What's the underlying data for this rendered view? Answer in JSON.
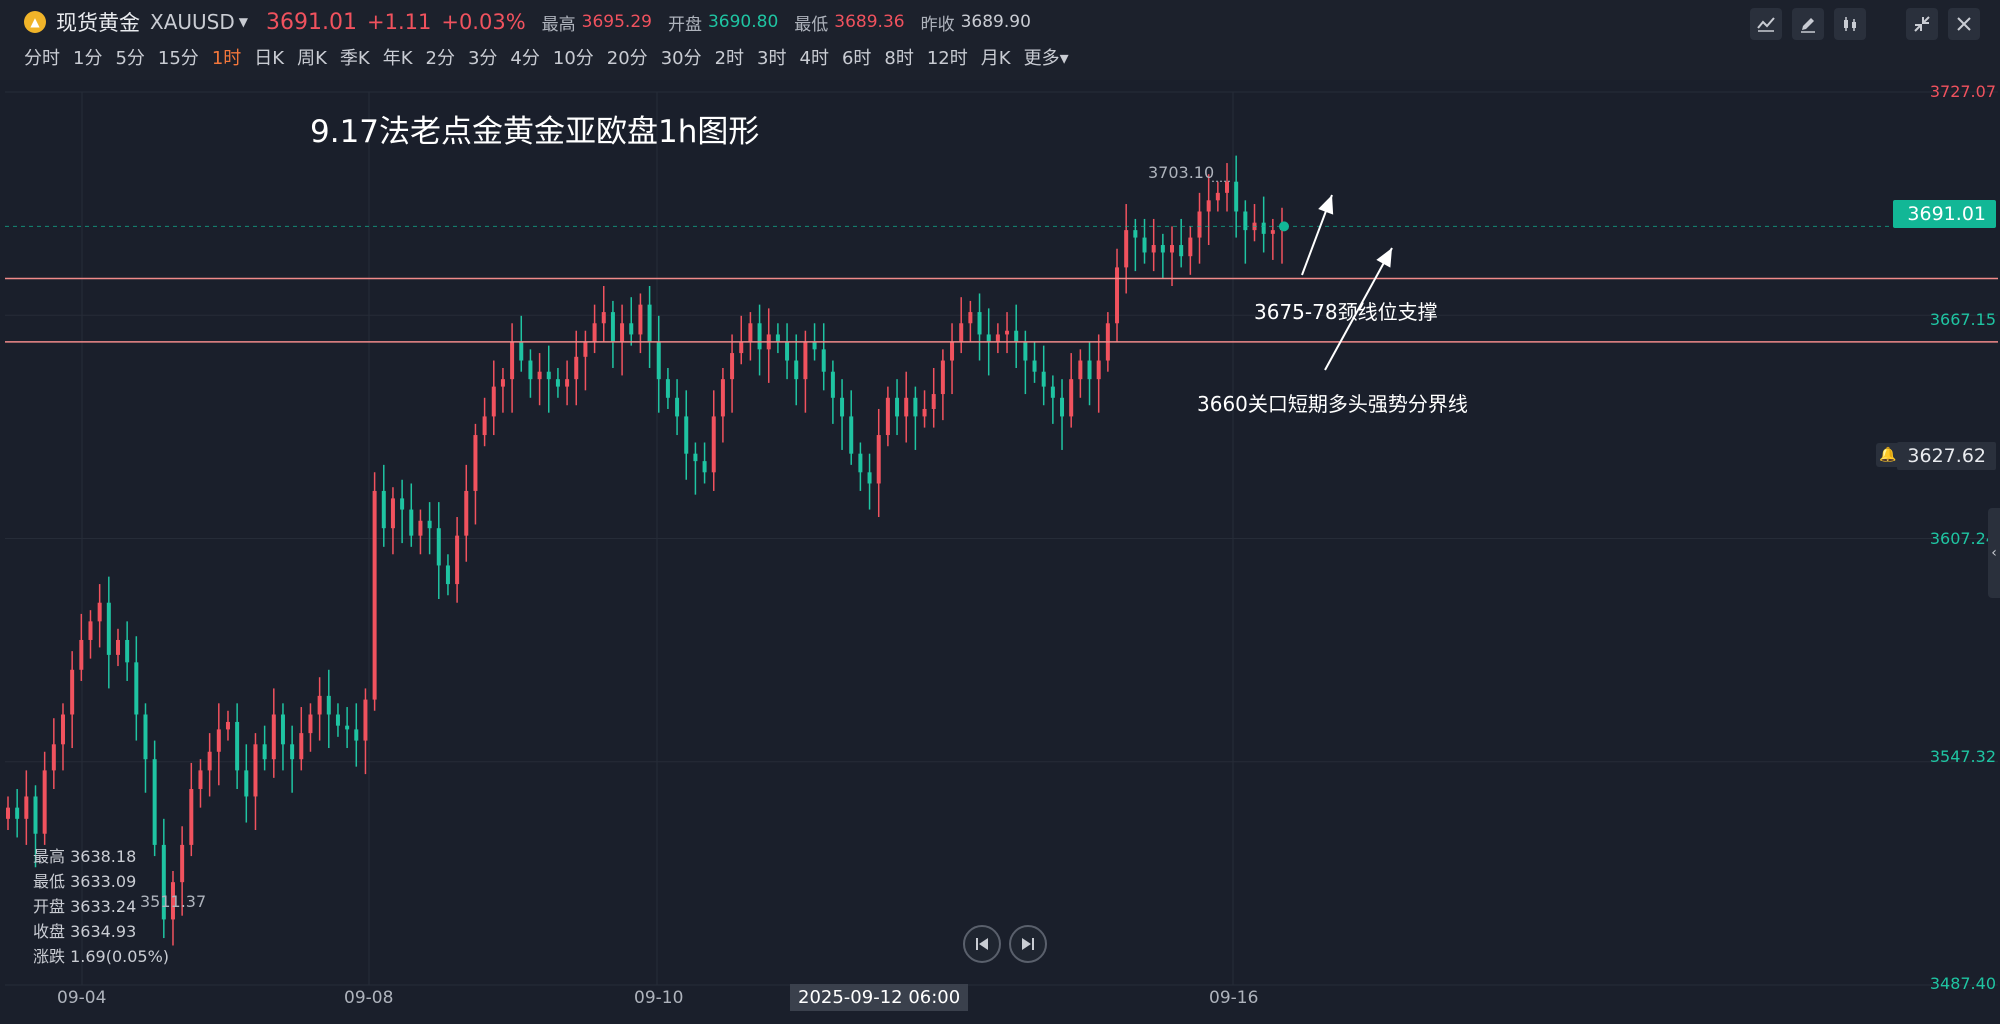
{
  "header": {
    "symbol_name": "现货黄金",
    "symbol_code": "XAUUSD",
    "price": "3691.01",
    "change": "+1.11",
    "change_pct": "+0.03%",
    "high_label": "最高",
    "high_value": "3695.29",
    "open_label": "开盘",
    "open_value": "3690.80",
    "low_label": "最低",
    "low_value": "3689.36",
    "prev_label": "昨收",
    "prev_value": "3689.90"
  },
  "timeframes": [
    "分时",
    "1分",
    "5分",
    "15分",
    "1时",
    "日K",
    "周K",
    "季K",
    "年K",
    "2分",
    "3分",
    "4分",
    "10分",
    "20分",
    "30分",
    "2时",
    "3时",
    "4时",
    "6时",
    "8时",
    "12时",
    "月K",
    "更多"
  ],
  "active_timeframe": "1时",
  "toolbar_icons": [
    "indicator-icon",
    "draw-pen-icon",
    "candle-style-icon",
    "collapse-icon",
    "close-icon"
  ],
  "chart_annotations": {
    "title": "9.17法老点金黄金亚欧盘1h图形",
    "neckline_label": "3675-78颈线位支撑",
    "boundary_label": "3660关口短期多头强势分界线",
    "peak_label": "3703.10",
    "low_label": "3511.37"
  },
  "yaxis": {
    "labels": [
      {
        "text": "3727.07",
        "color": "#f0525e"
      },
      {
        "text": "3667.15",
        "color": "#1fc4a2"
      },
      {
        "text": "3607.24",
        "color": "#1fc4a2"
      },
      {
        "text": "3547.32",
        "color": "#1fc4a2"
      },
      {
        "text": "3487.40",
        "color": "#1fc4a2"
      }
    ],
    "current_price_tag": "3691.01",
    "alert_price_tag": "3627.62"
  },
  "xaxis": {
    "labels": [
      "09-04",
      "09-08",
      "09-10",
      "09-16"
    ],
    "crosshair_time": "2025-09-12 06:00"
  },
  "info_box": {
    "rows": [
      {
        "label": "最高",
        "value": "3638.18"
      },
      {
        "label": "最低",
        "value": "3633.09"
      },
      {
        "label": "开盘",
        "value": "3633.24"
      },
      {
        "label": "收盘",
        "value": "3634.93"
      },
      {
        "label": "涨跌",
        "value": "1.69(0.05%)"
      }
    ]
  },
  "colors": {
    "up": "#f0525e",
    "down": "#1fc4a2",
    "background": "#1a1f2b",
    "support_line": "#f08a8a",
    "price_tag": "#12b796"
  },
  "chart_data": {
    "type": "candlestick",
    "instrument": "XAUUSD",
    "interval": "1h",
    "ylim": [
      3487.4,
      3727.07
    ],
    "y_ticks": [
      3727.07,
      3667.15,
      3607.24,
      3547.32,
      3487.4
    ],
    "x_labels": [
      "09-04",
      "09-08",
      "09-10",
      "09-16"
    ],
    "horizontal_lines": [
      {
        "label": "3675-78颈线位支撑",
        "value": 3677
      },
      {
        "label": "3660关口短期多头强势分界线",
        "value": 3660
      }
    ],
    "current_price": 3691.01,
    "alert_price": 3627.62,
    "marked_high": 3703.1,
    "marked_low": 3511.37,
    "closes": [
      3535,
      3532,
      3538,
      3528,
      3545,
      3552,
      3560,
      3572,
      3580,
      3585,
      3590,
      3576,
      3580,
      3574,
      3560,
      3548,
      3525,
      3505,
      3515,
      3525,
      3540,
      3545,
      3550,
      3556,
      3558,
      3545,
      3538,
      3552,
      3548,
      3560,
      3552,
      3548,
      3555,
      3560,
      3565,
      3560,
      3557,
      3556,
      3553,
      3564,
      3620,
      3610,
      3618,
      3615,
      3608,
      3612,
      3610,
      3600,
      3595,
      3608,
      3620,
      3635,
      3640,
      3648,
      3650,
      3660,
      3655,
      3650,
      3652,
      3650,
      3648,
      3650,
      3656,
      3660,
      3665,
      3668,
      3660,
      3665,
      3662,
      3670,
      3660,
      3650,
      3645,
      3640,
      3630,
      3628,
      3625,
      3640,
      3650,
      3657,
      3660,
      3665,
      3658,
      3662,
      3660,
      3655,
      3650,
      3660,
      3658,
      3652,
      3645,
      3640,
      3630,
      3625,
      3622,
      3635,
      3645,
      3640,
      3645,
      3640,
      3642,
      3646,
      3655,
      3660,
      3665,
      3668,
      3662,
      3660,
      3662,
      3663,
      3660,
      3655,
      3652,
      3648,
      3645,
      3640,
      3650,
      3655,
      3650,
      3655,
      3665,
      3680,
      3690,
      3688,
      3684,
      3686,
      3684,
      3686,
      3683,
      3688,
      3695,
      3698,
      3700,
      3703,
      3695,
      3690,
      3692,
      3689,
      3690,
      3691
    ]
  }
}
